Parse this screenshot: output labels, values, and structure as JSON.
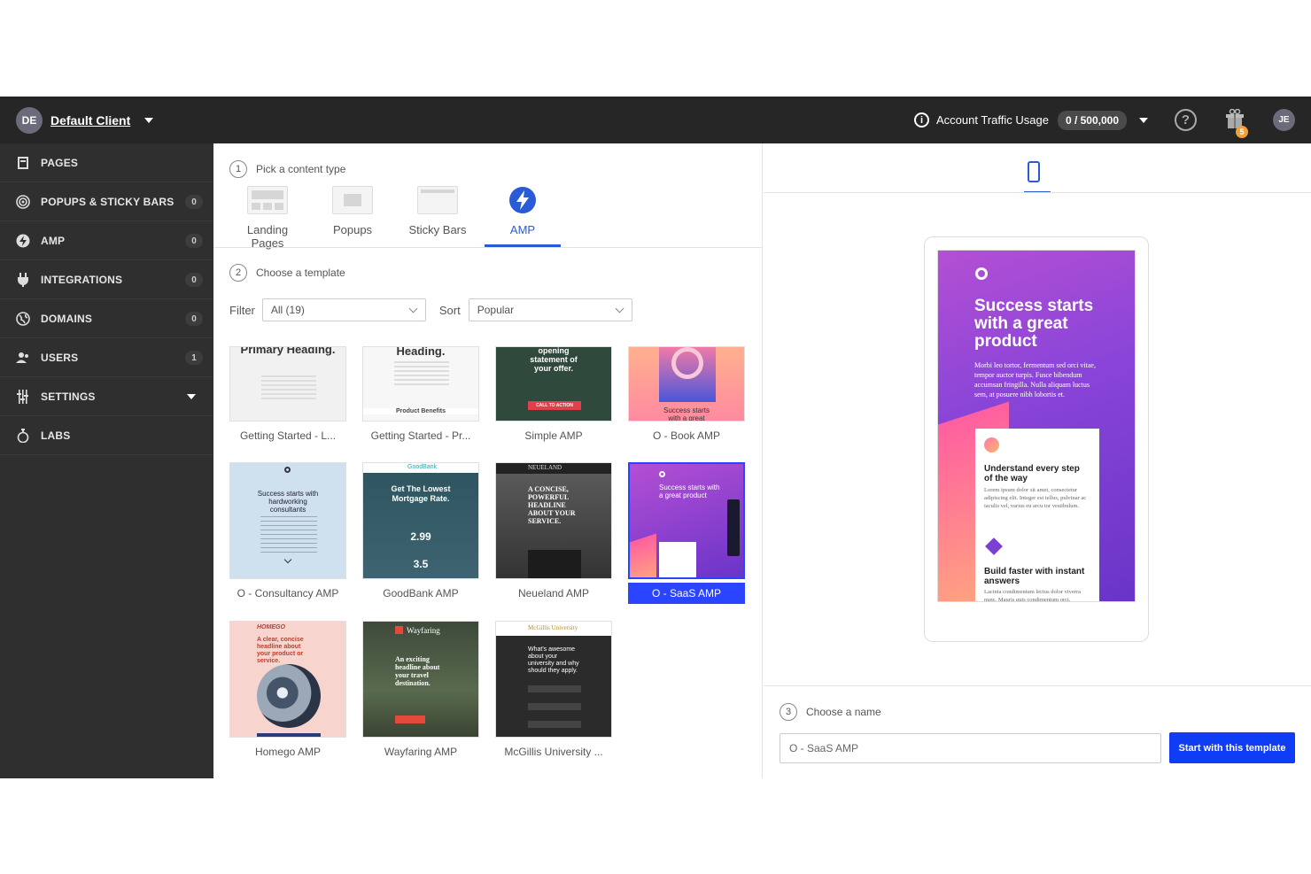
{
  "header": {
    "client_initials": "DE",
    "client_name": "Default Client",
    "traffic_label": "Account Traffic Usage",
    "traffic_value": "0 / 500,000",
    "gift_badge": "5",
    "user_initials": "JE"
  },
  "sidebar": {
    "items": [
      {
        "label": "PAGES",
        "icon": "page-icon",
        "count": ""
      },
      {
        "label": "POPUPS & STICKY BARS",
        "icon": "target-icon",
        "count": "0"
      },
      {
        "label": "AMP",
        "icon": "bolt-icon",
        "count": "0"
      },
      {
        "label": "INTEGRATIONS",
        "icon": "plug-icon",
        "count": "0"
      },
      {
        "label": "DOMAINS",
        "icon": "globe-icon",
        "count": "0"
      },
      {
        "label": "USERS",
        "icon": "users-icon",
        "count": "1"
      },
      {
        "label": "SETTINGS",
        "icon": "sliders-icon",
        "count": ""
      },
      {
        "label": "LABS",
        "icon": "flask-icon",
        "count": ""
      }
    ]
  },
  "steps": {
    "s1_num": "1",
    "s1_label": "Pick a content type",
    "s2_num": "2",
    "s2_label": "Choose a template",
    "s3_num": "3",
    "s3_label": "Choose a name"
  },
  "tabs": [
    "Landing Pages",
    "Popups",
    "Sticky Bars",
    "AMP"
  ],
  "filter": {
    "label": "Filter",
    "value": "All (19)"
  },
  "sort": {
    "label": "Sort",
    "value": "Popular"
  },
  "templates": [
    {
      "label": "Getting Started - L...",
      "thumb": "Primary Heading."
    },
    {
      "label": "Getting Started - Pr...",
      "thumb": "Heading.",
      "thumb2": "Product Benefits"
    },
    {
      "label": "Simple AMP",
      "thumb": "opening statement of your offer.",
      "thumb2": "CALL TO ACTION"
    },
    {
      "label": "O - Book AMP",
      "thumb": "Success starts with a great"
    },
    {
      "label": "O - Consultancy AMP",
      "thumb": "Success starts with hardworking consultants"
    },
    {
      "label": "GoodBank AMP",
      "thumb": "Get The Lowest Mortgage Rate.",
      "brand": "GoodBank",
      "v1": "2.99",
      "v2": "3.5"
    },
    {
      "label": "Neueland AMP",
      "thumb": "A CONCISE, POWERFUL HEADLINE ABOUT YOUR SERVICE.",
      "brand": "NEUELAND"
    },
    {
      "label": "O - SaaS AMP",
      "thumb": "Success starts with a great product"
    },
    {
      "label": "Homego AMP",
      "thumb": "A clear, concise headline about your product or service.",
      "brand": "HOMEGO"
    },
    {
      "label": "Wayfaring AMP",
      "thumb": "An exciting headline about your travel destination.",
      "brand": "Wayfaring"
    },
    {
      "label": "McGillis University ...",
      "thumb": "What's awesome about your university and why should they apply.",
      "brand": "McGillis University"
    }
  ],
  "preview": {
    "title": "Success starts with a great product",
    "body": "Morbi leo tortor, fermentum sed orci vitae, tempor auctor turpis. Fusce bibendum accumsan fringilla. Nulla aliquam luctus sem, at posuere nibh lobortis et.",
    "card1_h": "Understand every step of the way",
    "card1_p": "Lorem ipsum dolor sit amet, consectetur adipiscing elit. Integer est tellus, pulvinar ac iaculis vel, varius eu arcu tor vestibulum.",
    "card2_h": "Build faster with instant answers",
    "card2_p": "Lacinia condimentum lectus dolor viverra nunc. Mauris quis condimentum orci."
  },
  "name_input": {
    "value": "O - SaaS AMP"
  },
  "start_button": "Start with this template",
  "colors": {
    "accent": "#2a5bd7",
    "button": "#0f3cf5",
    "selected": "#2b44ff",
    "topbar": "#262626",
    "sidebar": "#2f2f2f"
  }
}
